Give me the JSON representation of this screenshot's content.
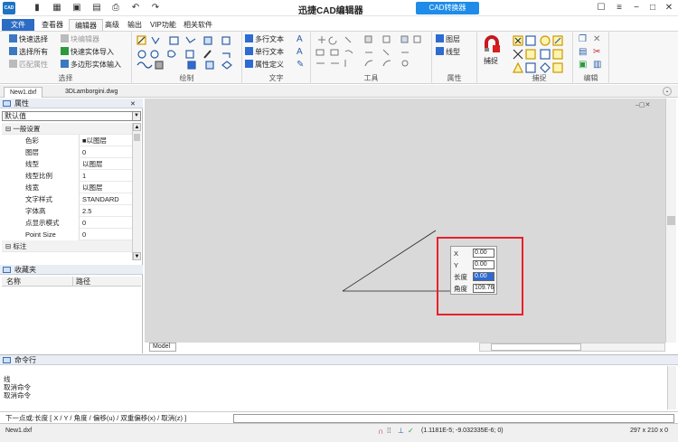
{
  "titlebar": {
    "logo": "CAD",
    "title": "迅捷CAD编辑器",
    "convert_button": "CAD转换器"
  },
  "menu": {
    "file": "文件",
    "tabs": [
      "查看器",
      "编辑器",
      "高级",
      "输出",
      "VIP功能",
      "相关软件"
    ]
  },
  "ribbon": {
    "select_group": {
      "label": "选择",
      "items": [
        "快速选择",
        "选择所有",
        "匹配属性"
      ],
      "items2": [
        "块编辑器",
        "快速实体导入",
        "多边形实体输入"
      ]
    },
    "draw_group": {
      "label": "绘制"
    },
    "text_group": {
      "label": "文字",
      "items": [
        "多行文本",
        "单行文本",
        "属性定义"
      ]
    },
    "tools_group": {
      "label": "工具"
    },
    "props_group": {
      "label": "属性",
      "items": [
        "图层",
        "线型"
      ]
    },
    "snap_group": {
      "label": "捕捉",
      "big": "捕捉"
    },
    "edit_group": {
      "label": "编辑"
    }
  },
  "doc_tabs": [
    "New1.dxf",
    "3DLamborgini.dwg"
  ],
  "properties": {
    "title": "属性",
    "combo": "默认值",
    "section_general": "一般设置",
    "rows": [
      {
        "k": "色彩",
        "v": "■以图层"
      },
      {
        "k": "图层",
        "v": "0"
      },
      {
        "k": "线型",
        "v": "以图层"
      },
      {
        "k": "线型比例",
        "v": "1"
      },
      {
        "k": "线宽",
        "v": "以图层"
      },
      {
        "k": "文字样式",
        "v": "STANDARD"
      },
      {
        "k": "字体高",
        "v": "2.5"
      },
      {
        "k": "点显示模式",
        "v": "0"
      },
      {
        "k": "Point Size",
        "v": "0"
      }
    ],
    "section_annot": "标注"
  },
  "favorites": {
    "title": "收藏夹",
    "col_name": "名称",
    "col_path": "路径"
  },
  "canvas": {
    "model_tab": "Model",
    "dyn": [
      {
        "label": "X",
        "value": "0.00"
      },
      {
        "label": "Y",
        "value": "0.00"
      },
      {
        "label": "长度",
        "value": "0.00"
      },
      {
        "label": "角度",
        "value": "109.76"
      }
    ]
  },
  "cmd": {
    "title": "命令行",
    "history": [
      "线",
      "取消命令",
      "取消命令"
    ],
    "prompt": "下一点或:长度 [ X / Y / 角度 / 偏移(u) / 双重偏移(x) / 取消(z) ]"
  },
  "status": {
    "file": "New1.dxf",
    "coords": "(1.1181E-5; -9.032335E-6; 0)",
    "paper": "297 x 210 x 0"
  },
  "colors": {
    "accent": "#1e72c4",
    "redbox": "#e8202a",
    "canvas_bg": "#d9d9d9"
  }
}
